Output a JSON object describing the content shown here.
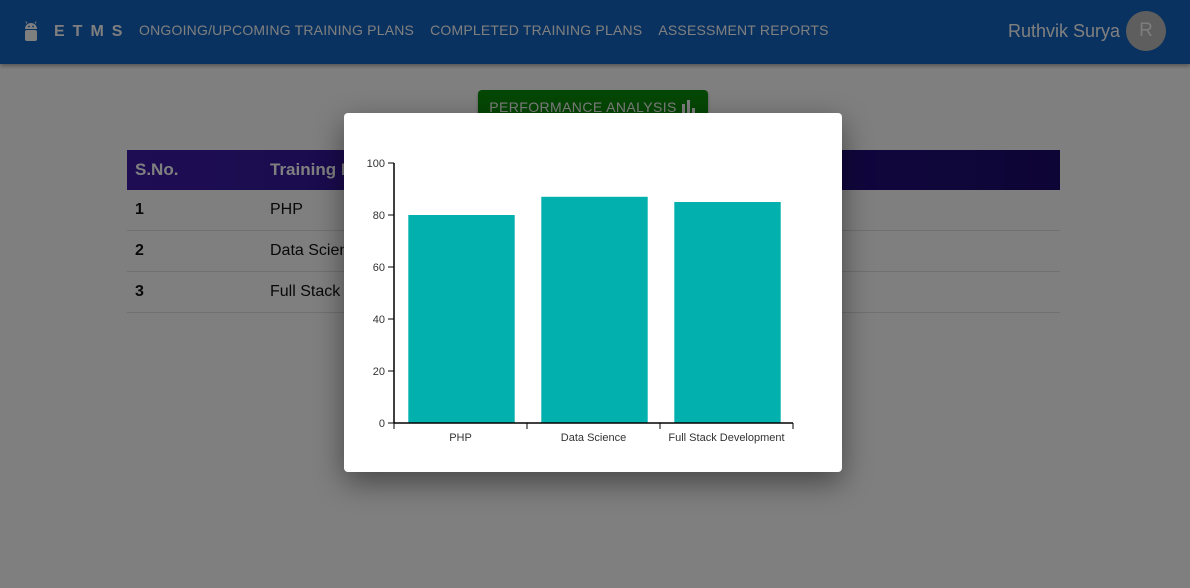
{
  "app": {
    "brand": "ETMS",
    "nav": [
      "ONGOING/UPCOMING TRAINING PLANS",
      "COMPLETED TRAINING PLANS",
      "ASSESSMENT REPORTS"
    ],
    "user_name": "Ruthvik Surya",
    "avatar_initial": "R",
    "colors": {
      "appbar": "#1565c0",
      "button": "#0a8f0a",
      "table_header": "#2a1290",
      "bar": "#02b0ad"
    }
  },
  "main": {
    "performance_button": "PERFORMANCE ANALYSIS",
    "table": {
      "headers": [
        "S.No.",
        "Training N"
      ],
      "rows": [
        {
          "sno": "1",
          "name": "PHP"
        },
        {
          "sno": "2",
          "name": "Data Scien"
        },
        {
          "sno": "3",
          "name": "Full Stack D"
        }
      ]
    }
  },
  "chart_data": {
    "type": "bar",
    "categories": [
      "PHP",
      "Data Science",
      "Full Stack Development"
    ],
    "values": [
      80,
      87,
      85
    ],
    "ylim": [
      0,
      100
    ],
    "yticks": [
      0,
      20,
      40,
      60,
      80,
      100
    ],
    "title": "",
    "xlabel": "",
    "ylabel": "",
    "grid": false
  }
}
